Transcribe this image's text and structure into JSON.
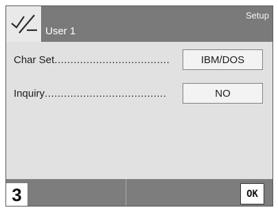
{
  "header": {
    "app_icon": "checkmark-slash-icon",
    "user": "User 1",
    "screen_title": "Setup"
  },
  "settings": [
    {
      "label": "Char Set",
      "dots": "....................................",
      "value": "IBM/DOS"
    },
    {
      "label": "Inquiry",
      "dots": "......................................",
      "value": "NO"
    }
  ],
  "footer": {
    "step": "3",
    "ok_label": "OK"
  },
  "colors": {
    "header_bg": "#7a7a7a",
    "body_bg": "#e1e1e1",
    "footer_bg": "#7d7d7d",
    "button_bg": "#f3f3f3"
  }
}
